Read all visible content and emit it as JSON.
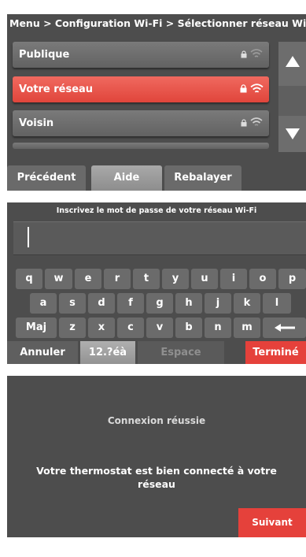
{
  "screen1": {
    "breadcrumb": "Menu > Configuration Wi-Fi > Sélectionner réseau Wi-Fi",
    "networks": [
      {
        "name": "Publique",
        "selected": false
      },
      {
        "name": "Votre réseau",
        "selected": true
      },
      {
        "name": "Voisin",
        "selected": false
      }
    ],
    "buttons": {
      "previous": "Précédent",
      "help": "Aide",
      "rescan": "Rebalayer"
    }
  },
  "screen2": {
    "title": "Inscrivez le mot de passe de votre réseau Wi-Fi",
    "password_value": "",
    "rows": [
      [
        "q",
        "w",
        "e",
        "r",
        "t",
        "y",
        "u",
        "i",
        "o",
        "p"
      ],
      [
        "a",
        "s",
        "d",
        "f",
        "g",
        "h",
        "j",
        "k",
        "l"
      ],
      [
        "z",
        "x",
        "c",
        "v",
        "b",
        "n",
        "m"
      ]
    ],
    "shift_label": "Maj",
    "buttons": {
      "cancel": "Annuler",
      "symbols": "12.?éà",
      "space": "Espace",
      "done": "Terminé"
    }
  },
  "screen3": {
    "title": "Connexion réussie",
    "message": "Votre thermostat est bien connecté à votre réseau",
    "next": "Suivant"
  },
  "colors": {
    "accent": "#e5413b",
    "panel": "#4d4d4d",
    "button": "#6b6b6b"
  },
  "icons": {
    "lock": "lock-icon",
    "wifi": "wifi-icon",
    "scroll_up": "triangle-up-icon",
    "scroll_down": "triangle-down-icon",
    "backspace": "arrow-left-icon"
  }
}
